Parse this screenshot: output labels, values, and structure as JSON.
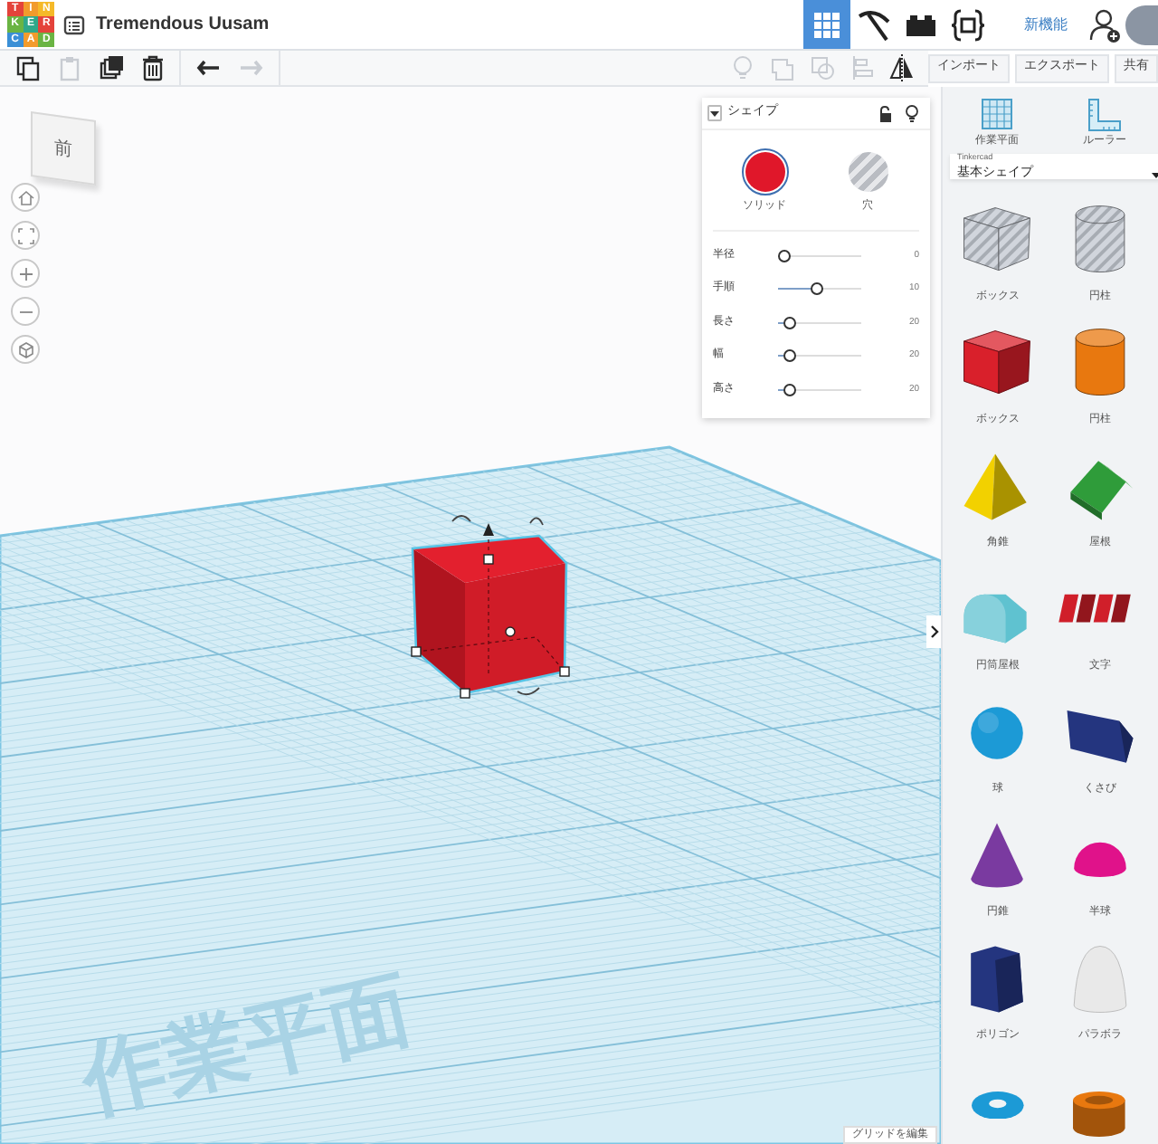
{
  "header": {
    "logo_rows": [
      [
        "T",
        "I",
        "N"
      ],
      [
        "K",
        "E",
        "R"
      ],
      [
        "C",
        "A",
        "D"
      ]
    ],
    "title": "Tremendous Uusam",
    "nav": [
      {
        "kind": "grid",
        "selected": true
      },
      {
        "kind": "pickaxe",
        "selected": false
      },
      {
        "kind": "bricks",
        "selected": false
      },
      {
        "kind": "codeblocks",
        "selected": false
      }
    ],
    "whats_new": "新機能"
  },
  "toolbar": {
    "tools": [
      {
        "kind": "copy",
        "disabled": false
      },
      {
        "kind": "paste",
        "disabled": true
      },
      {
        "kind": "duplicate",
        "disabled": false
      },
      {
        "kind": "delete",
        "disabled": false
      },
      {
        "kind": "undo",
        "disabled": false
      },
      {
        "kind": "redo",
        "disabled": true
      }
    ],
    "view_tools": [
      {
        "kind": "light",
        "disabled": true
      },
      {
        "kind": "group",
        "disabled": true
      },
      {
        "kind": "ungroup",
        "disabled": true
      },
      {
        "kind": "align",
        "disabled": true
      },
      {
        "kind": "mirror",
        "disabled": false
      }
    ],
    "buttons": [
      "インポート",
      "エクスポート",
      "共有"
    ]
  },
  "view_cube": {
    "face": "前"
  },
  "inspector": {
    "title": "シェイプ",
    "modes": [
      {
        "label": "ソリッド",
        "kind": "solid",
        "selected": true
      },
      {
        "label": "穴",
        "kind": "hole",
        "selected": false
      }
    ],
    "params": [
      {
        "label": "半径",
        "level": 0,
        "reading": "0"
      },
      {
        "label": "手順",
        "level": 0.45,
        "reading": "10"
      },
      {
        "label": "長さ",
        "level": 0.08,
        "reading": "20"
      },
      {
        "label": "幅",
        "level": 0.08,
        "reading": "20"
      },
      {
        "label": "高さ",
        "level": 0.08,
        "reading": "20"
      }
    ]
  },
  "workplane": {
    "plane_label": "作業平面",
    "edit_grid": "グリッドを編集"
  },
  "library": {
    "tools": [
      {
        "label": "作業平面",
        "kind": "workplane"
      },
      {
        "label": "ルーラー",
        "kind": "ruler"
      }
    ],
    "source": "Tinkercad",
    "category": "基本シェイプ",
    "shapes": [
      {
        "label": "ボックス",
        "kind": "box",
        "color": "#c5cad3",
        "hole": true
      },
      {
        "label": "円柱",
        "kind": "cylinder",
        "color": "#c5cad3",
        "hole": true
      },
      {
        "label": "ボックス",
        "kind": "box",
        "color": "#d9202b",
        "hole": false
      },
      {
        "label": "円柱",
        "kind": "cylinder",
        "color": "#e8780f",
        "hole": false
      },
      {
        "label": "角錐",
        "kind": "pyramid",
        "color": "#f2d100",
        "hole": false
      },
      {
        "label": "屋根",
        "kind": "roof",
        "color": "#2f9c3a",
        "hole": false
      },
      {
        "label": "円筒屋根",
        "kind": "round-roof",
        "color": "#5fc2d0",
        "hole": false
      },
      {
        "label": "文字",
        "kind": "text",
        "color": "#d01f2a",
        "hole": false
      },
      {
        "label": "球",
        "kind": "sphere",
        "color": "#1c9ad6",
        "hole": false
      },
      {
        "label": "くさび",
        "kind": "wedge",
        "color": "#24357f",
        "hole": false
      },
      {
        "label": "円錐",
        "kind": "cone",
        "color": "#7a3aa0",
        "hole": false
      },
      {
        "label": "半球",
        "kind": "hemisphere",
        "color": "#e0128a",
        "hole": false
      },
      {
        "label": "ポリゴン",
        "kind": "polygon",
        "color": "#24357f",
        "hole": false
      },
      {
        "label": "パラボラ",
        "kind": "paraboloid",
        "color": "#e9e9e9",
        "hole": false
      },
      {
        "kind": "torus",
        "color": "#1c9ad6",
        "hole": false
      },
      {
        "kind": "tube",
        "color": "#e8780f",
        "hole": false
      }
    ]
  }
}
